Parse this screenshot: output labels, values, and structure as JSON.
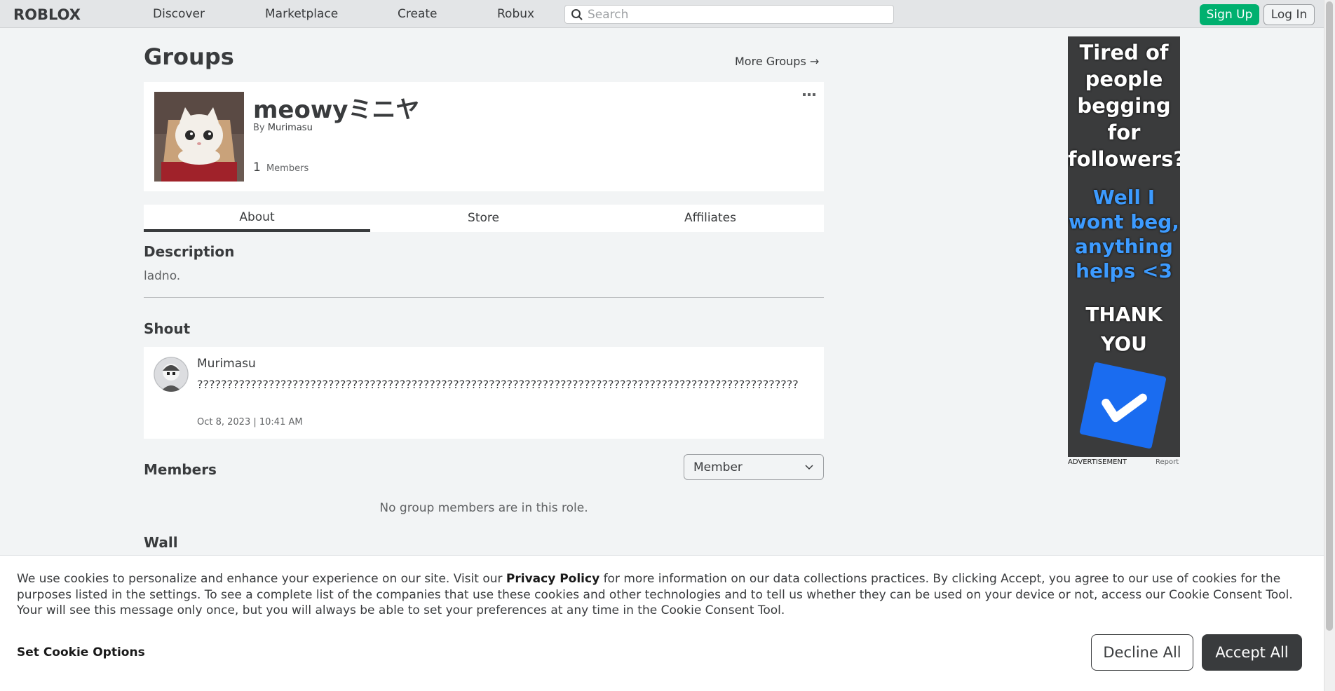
{
  "header": {
    "logo_text": "ROBLOX",
    "nav": [
      "Discover",
      "Marketplace",
      "Create",
      "Robux"
    ],
    "search_placeholder": "Search",
    "signup_label": "Sign Up",
    "login_label": "Log In"
  },
  "page": {
    "title": "Groups",
    "more_groups": "More Groups"
  },
  "group": {
    "name": "meowyミニヤ",
    "by_label": "By",
    "owner": "Murimasu",
    "member_count": "1",
    "members_label": "Members"
  },
  "tabs": [
    {
      "label": "About",
      "active": true
    },
    {
      "label": "Store",
      "active": false
    },
    {
      "label": "Affiliates",
      "active": false
    }
  ],
  "description": {
    "heading": "Description",
    "text": "ladno."
  },
  "shout": {
    "heading": "Shout",
    "user": "Murimasu",
    "body": "?????????????????????????????????????????????????????????????????????????????????????????????????????",
    "date": "Oct 8, 2023 | 10:41 AM"
  },
  "members": {
    "heading": "Members",
    "role_selected": "Member",
    "empty_text": "No group members are in this role."
  },
  "wall": {
    "heading": "Wall"
  },
  "ad": {
    "line1": "Tired of people begging for followers?",
    "line2": "Well I wont beg, anything helps <3",
    "line3": "THANK YOU",
    "label": "ADVERTISEMENT",
    "report": "Report"
  },
  "cookie": {
    "text_before": "We use cookies to personalize and enhance your experience on our site. Visit our ",
    "privacy_link": "Privacy Policy",
    "text_after": " for more information on our data collections practices. By clicking Accept, you agree to our use of cookies for the purposes listed in the settings. To see a complete list of the companies that use these cookies and other technologies and to tell us whether they can be used on your device or not, access our Cookie Consent Tool. Your will see this message only once, but you will always be able to set your preferences at any time in the Cookie Consent Tool.",
    "set_options": "Set Cookie Options",
    "decline": "Decline All",
    "accept": "Accept All"
  },
  "colors": {
    "signup_green": "#00b06f",
    "ad_blue": "#3d9bff",
    "background": "#f2f4f5"
  }
}
